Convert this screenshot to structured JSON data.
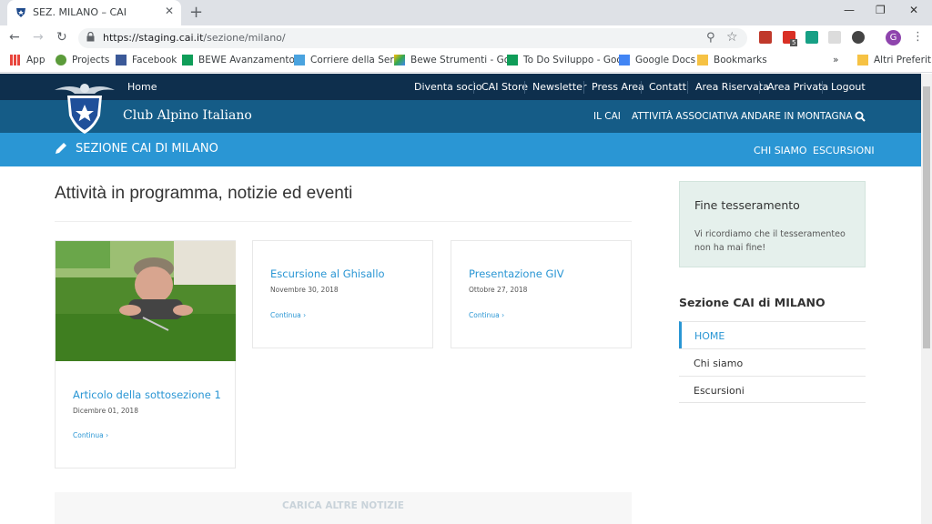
{
  "browser": {
    "tab_title": "SEZ. MILANO – CAI",
    "url_host": "https://staging.cai.it",
    "url_path": "/sezione/milano/",
    "extension_badge": "5",
    "profile_initial": "G",
    "bookmarks": [
      "App",
      "Projects",
      "Facebook",
      "BEWE Avanzamento",
      "Corriere della Sera",
      "Bewe Strumenti - Go",
      "To Do Sviluppo - Goo",
      "Google Docs",
      "Bookmarks"
    ],
    "overflow": "»",
    "other_bookmarks": "Altri Preferiti"
  },
  "topnav": {
    "home": "Home",
    "links": [
      "Diventa socio",
      "CAI Store",
      "Newsletter",
      "Press Area",
      "Contatti",
      "Area Riservata",
      "Area Privata",
      "Logout"
    ]
  },
  "mainnav": {
    "brand": "Club Alpino Italiano",
    "links": [
      "IL CAI",
      "ATTIVITÀ ASSOCIATIVA",
      "ANDARE IN MONTAGNA"
    ]
  },
  "section": {
    "title": "SEZIONE CAI DI MILANO",
    "links": [
      "CHI SIAMO",
      "ESCURSIONI"
    ]
  },
  "main": {
    "title": "Attività in programma, notizie ed eventi",
    "cards": [
      {
        "title": "Articolo della sottosezione 1",
        "date": "Dicembre 01, 2018",
        "more": "Continua ›"
      },
      {
        "title": "Escursione al Ghisallo",
        "date": "Novembre 30, 2018",
        "more": "Continua ›"
      },
      {
        "title": "Presentazione GIV",
        "date": "Ottobre 27, 2018",
        "more": "Continua ›"
      }
    ],
    "load_more": "CARICA ALTRE NOTIZIE"
  },
  "sidebar": {
    "box_title": "Fine tesseramento",
    "box_text": "Vi ricordiamo che il tesseramenteo non ha mai fine!",
    "menu_title": "Sezione CAI di MILANO",
    "menu": [
      "HOME",
      "Chi siamo",
      "Escursioni"
    ]
  },
  "colors": {
    "dark_nav": "#0e2f4d",
    "main_nav": "#155c87",
    "section_bar": "#2a96d4",
    "sidebox": "#e5f0ec"
  }
}
